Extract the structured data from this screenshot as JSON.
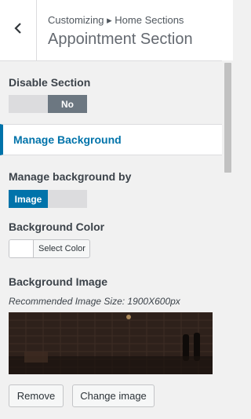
{
  "header": {
    "breadcrumb": "Customizing ▸ Home Sections",
    "title": "Appointment Section"
  },
  "disable_section": {
    "label": "Disable Section",
    "toggle_off_label": "",
    "toggle_on_label": "No"
  },
  "manage_background_panel": {
    "label": "Manage Background"
  },
  "manage_background_by": {
    "label": "Manage background by",
    "active_option": "Image",
    "inactive_option": ""
  },
  "background_color": {
    "label": "Background Color",
    "button_label": "Select Color",
    "swatch_color": "#ffffff"
  },
  "background_image": {
    "label": "Background Image",
    "recommended_size": "Recommended Image Size: 1900X600px"
  },
  "buttons": {
    "remove": "Remove",
    "change_image": "Change image"
  },
  "colors": {
    "accent": "#0073aa",
    "toggle_active": "#6c7781",
    "toggle_bg": "#dcdcde"
  }
}
